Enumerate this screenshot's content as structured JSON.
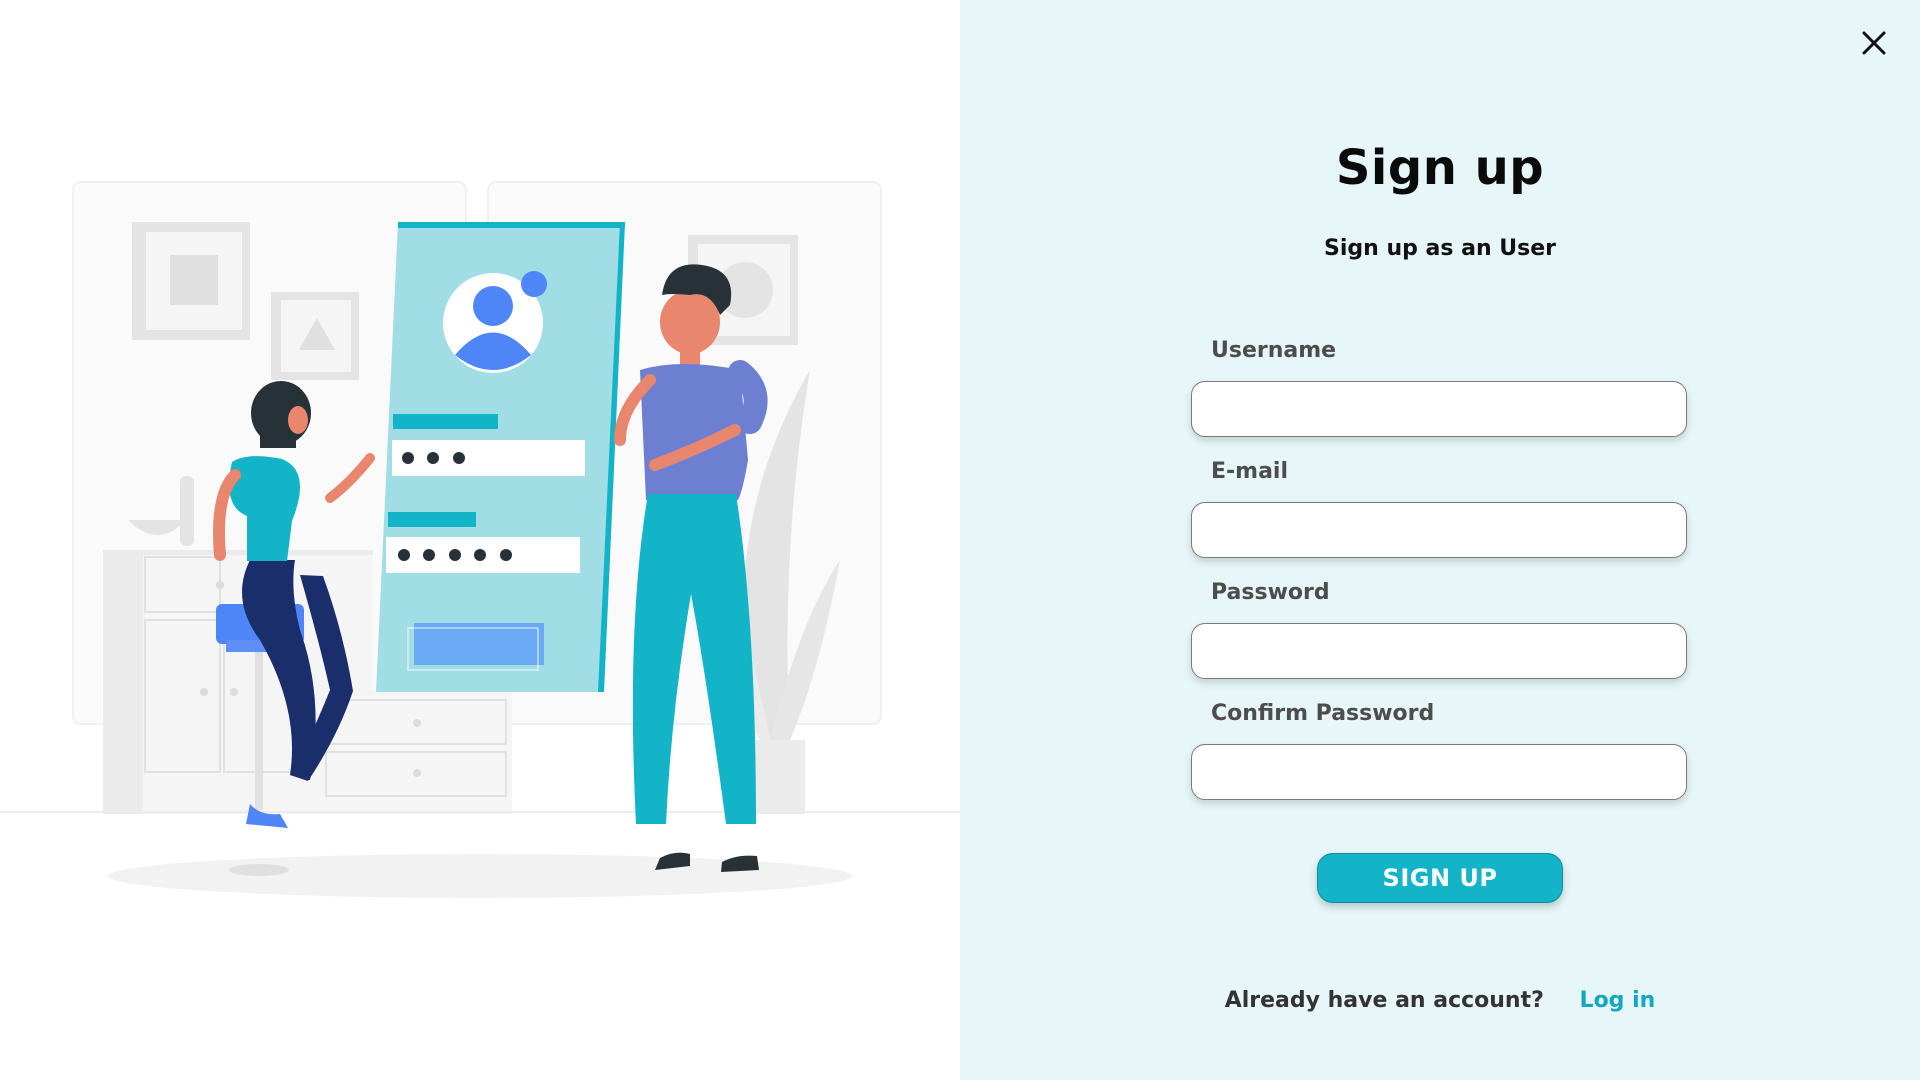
{
  "colors": {
    "accent": "#13b3c8",
    "panel_bg": "#e6f6f9",
    "link": "#13a8c0"
  },
  "illustration": {
    "name": "sign-up-illustration"
  },
  "header": {
    "close_icon": "close-icon"
  },
  "form": {
    "title": "Sign up",
    "subtitle": "Sign up as an User",
    "fields": [
      {
        "label": "Username",
        "value": "",
        "placeholder": ""
      },
      {
        "label": "E-mail",
        "value": "",
        "placeholder": ""
      },
      {
        "label": "Password",
        "value": "",
        "placeholder": ""
      },
      {
        "label": "Confirm Password",
        "value": "",
        "placeholder": ""
      }
    ],
    "submit_label": "SIGN UP"
  },
  "footer": {
    "prompt": "Already have an account?",
    "login_label": "Log in"
  }
}
